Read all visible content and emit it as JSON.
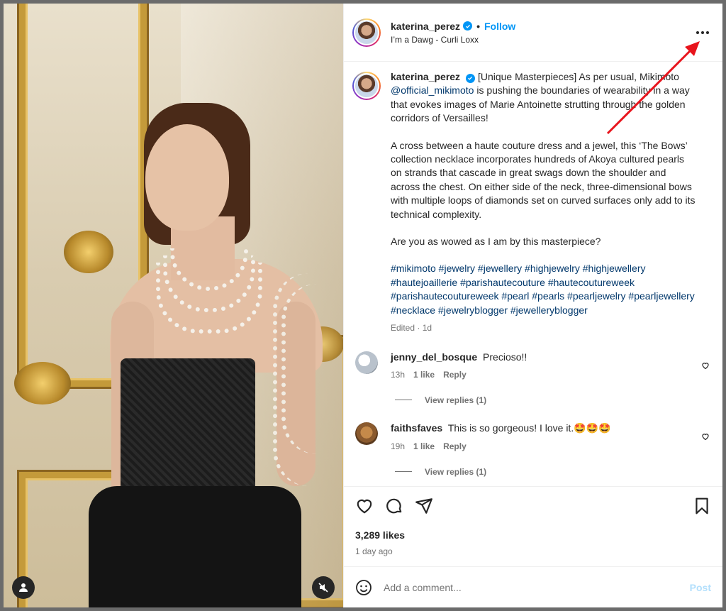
{
  "header": {
    "username": "katerina_perez",
    "separator": "•",
    "follow_label": "Follow",
    "audio": "I’m a Dawg - Curli Loxx"
  },
  "caption": {
    "username": "katerina_perez",
    "p1_a": "[Unique Masterpieces] As per usual, Mikimoto ",
    "p1_mention": "@official_mikimoto",
    "p1_b": " is pushing the boundaries of wearability in a way that evokes images of Marie Antoinette strutting through the golden corridors of Versailles!",
    "p2": "A cross between a haute couture dress and a jewel, this ‘The Bows’ collection necklace incorporates hundreds of Akoya cultured pearls on strands that cascade in great swags down the shoulder and across the chest. On either side of the neck, three-dimensional bows with multiple loops of diamonds set on curved surfaces only add to its technical complexity.",
    "p3": "Are you as wowed as I am by this masterpiece?",
    "hashtags": "#mikimoto #jewelry #jewellery #highjewelry #highjewellery #hautejoaillerie #parishautecouture #hautecoutureweek #parishautecoutureweek #pearl #pearls #pearljewelry #pearljewellery #necklace #jewelryblogger #jewelleryblogger",
    "meta": "Edited · 1d"
  },
  "comments": [
    {
      "username": "jenny_del_bosque",
      "text": "Precioso!!",
      "time": "13h",
      "likes": "1 like",
      "reply_label": "Reply",
      "view_replies": "View replies (1)"
    },
    {
      "username": "faithsfaves",
      "text": "This is so gorgeous! I love it.🤩🤩🤩",
      "time": "19h",
      "likes": "1 like",
      "reply_label": "Reply",
      "view_replies": "View replies (1)"
    }
  ],
  "post_stats": {
    "likes": "3,289 likes",
    "date": "1 day ago"
  },
  "add_comment": {
    "placeholder": "Add a comment...",
    "post_label": "Post"
  },
  "colors": {
    "accent": "#0095f6",
    "annotation_arrow": "#e8141c",
    "hashtag": "#00376b"
  }
}
